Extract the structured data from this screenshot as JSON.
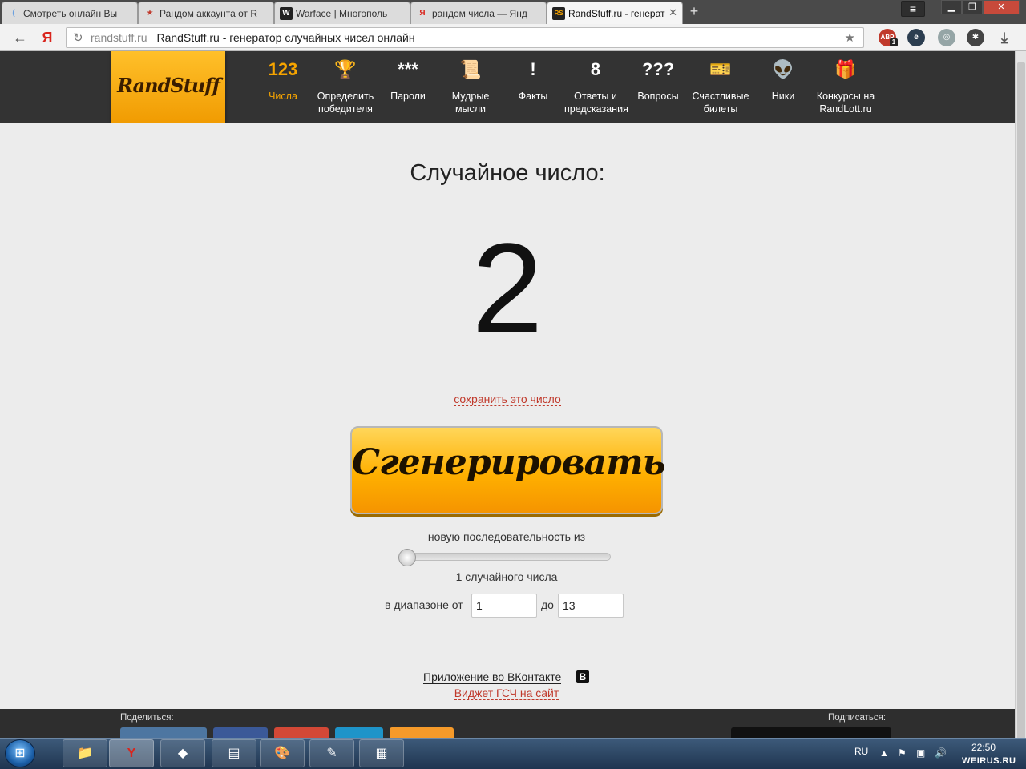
{
  "browser": {
    "tabs": [
      {
        "title": "Смотреть онлайн Вы",
        "favicon": "("
      },
      {
        "title": "Рандом аккаунта от R",
        "favicon": "★"
      },
      {
        "title": "Warface | Многополь",
        "favicon": "W"
      },
      {
        "title": "рандом числа — Янд",
        "favicon": "Я"
      },
      {
        "title": "RandStuff.ru - генерат",
        "favicon": "RS"
      }
    ],
    "address": {
      "domain": "randstuff.ru",
      "page_title": "RandStuff.ru - генератор случайных чисел онлайн"
    },
    "menu_icon": "hamburger-icon",
    "abp_badge": "ABP",
    "abp_count": "1"
  },
  "site": {
    "logo": "RandStuff",
    "nav": [
      {
        "icon": "123",
        "label": "Числа",
        "active": true
      },
      {
        "icon": "🏆",
        "label": "Определить победителя"
      },
      {
        "icon": "***",
        "label": "Пароли"
      },
      {
        "icon": "📜",
        "label": "Мудрые мысли"
      },
      {
        "icon": "!",
        "label": "Факты"
      },
      {
        "icon": "8",
        "label": "Ответы и предсказания"
      },
      {
        "icon": "???",
        "label": "Вопросы"
      },
      {
        "icon": "🎫",
        "label": "Счастливые билеты"
      },
      {
        "icon": "👽",
        "label": "Ники"
      },
      {
        "icon": "🎁",
        "label": "Конкурсы на RandLott.ru"
      }
    ],
    "accent_color": "#f6a400"
  },
  "main": {
    "heading": "Случайное число:",
    "result": "2",
    "save_link": "сохранить это число",
    "generate_button": "Сгенерировать",
    "sequence_label": "новую последовательность из",
    "slider_value": 1,
    "count_label": "1 случайного числа",
    "range_from_label": "в диапазоне от",
    "range_to_label": "до",
    "range_from": "1",
    "range_to": "13",
    "vk_app_link": "Приложение во ВКонтакте",
    "vk_badge": "В",
    "widget_link": "Виджет ГСЧ на сайт"
  },
  "footer": {
    "share_label": "Поделиться:",
    "subscribe_label": "Подписаться:"
  },
  "taskbar": {
    "lang": "RU",
    "time": "22:50",
    "watermark": "WEIRUS.RU"
  }
}
